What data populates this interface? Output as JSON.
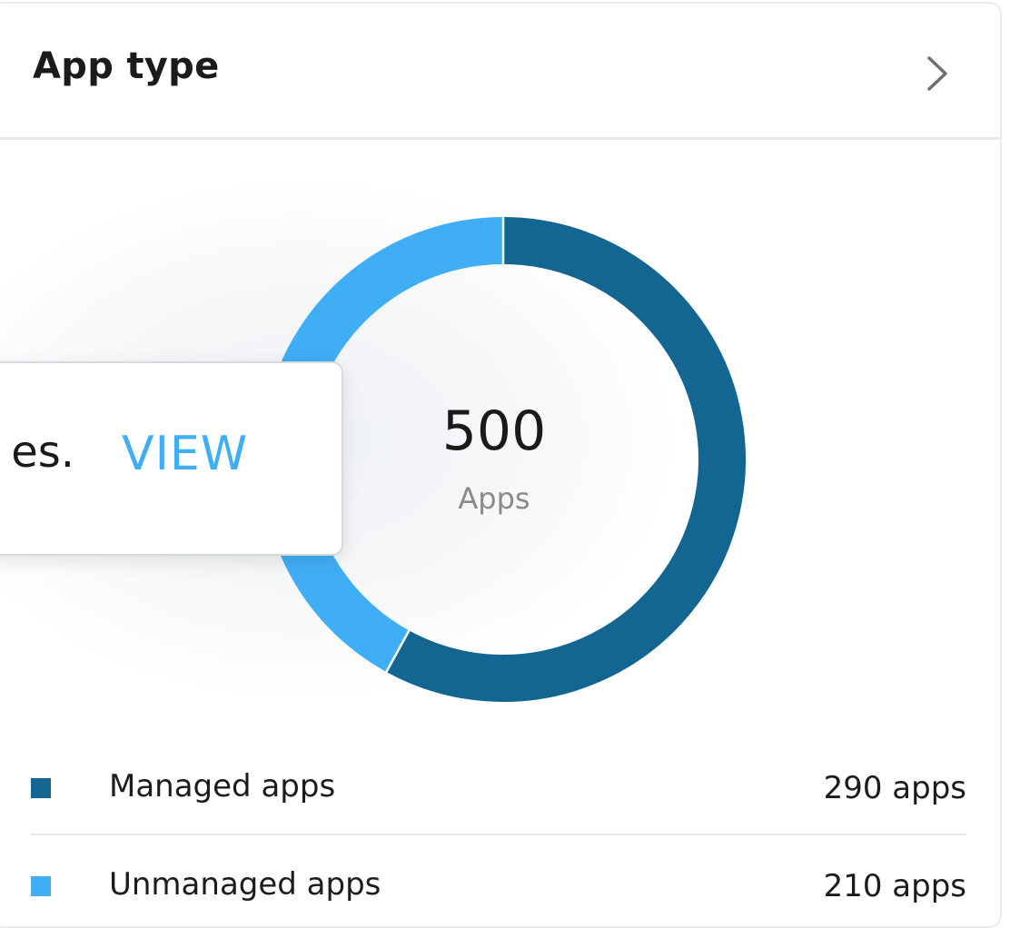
{
  "card": {
    "title": "App type"
  },
  "popover": {
    "text_fragment": "es.",
    "action_label": "VIEW"
  },
  "chart_data": {
    "type": "pie",
    "variant": "donut",
    "total": 500,
    "center_label": "Apps",
    "categories": [
      "Managed apps",
      "Unmanaged apps"
    ],
    "values": [
      290,
      210
    ],
    "value_labels": [
      "290 apps",
      "210 apps"
    ],
    "colors": [
      "#136691",
      "#40aef4"
    ],
    "legend_placement": "bottom"
  }
}
